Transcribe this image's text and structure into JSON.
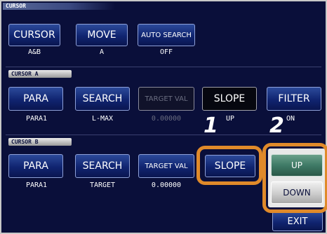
{
  "header": {
    "title": "CURSOR"
  },
  "top_row": {
    "cursor": {
      "label": "CURSOR",
      "value": "A&B"
    },
    "move": {
      "label": "MOVE",
      "value": "A"
    },
    "auto_search": {
      "label": "AUTO SEARCH",
      "value": "OFF"
    }
  },
  "cursor_a": {
    "title": "CURSOR A",
    "para": {
      "label": "PARA",
      "value": "PARA1"
    },
    "search": {
      "label": "SEARCH",
      "value": "L-MAX"
    },
    "target_val": {
      "label": "TARGET VAL",
      "value": "0.00000"
    },
    "slope": {
      "label": "SLOPE",
      "value": "UP"
    },
    "filter": {
      "label": "FILTER",
      "value": "ON"
    }
  },
  "cursor_b": {
    "title": "CURSOR B",
    "para": {
      "label": "PARA",
      "value": "PARA1"
    },
    "search": {
      "label": "SEARCH",
      "value": "TARGET"
    },
    "target_val": {
      "label": "TARGET VAL",
      "value": "0.00000"
    },
    "slope": {
      "label": "SLOPE"
    }
  },
  "popup": {
    "up": "UP",
    "down": "DOWN"
  },
  "exit": {
    "label": "EXIT"
  },
  "callouts": {
    "step1": "1",
    "step2": "2"
  },
  "colors": {
    "highlight": "#e08a2a",
    "background": "#0a0f3a",
    "selected": "#3f7a66"
  }
}
